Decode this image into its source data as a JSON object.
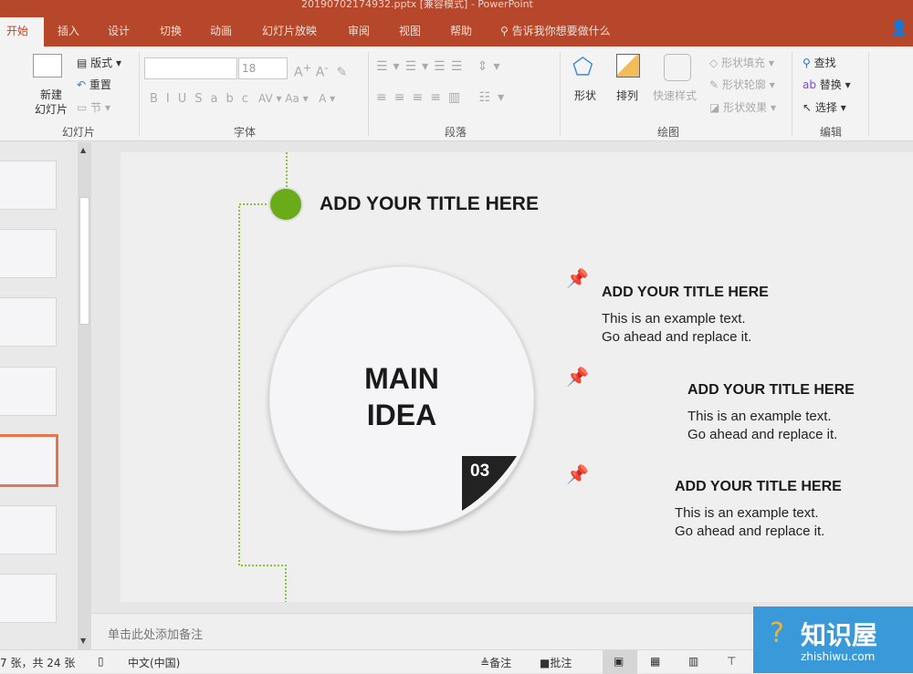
{
  "window": {
    "title": "20190702174932.pptx [兼容模式] - PowerPoint"
  },
  "tabs": [
    "开始",
    "插入",
    "设计",
    "切换",
    "动画",
    "幻灯片放映",
    "审阅",
    "视图",
    "帮助"
  ],
  "tell_me": "告诉我你想要做什么",
  "ribbon": {
    "slides": {
      "label": "幻灯片",
      "new_slide": "新建\n幻灯片",
      "layout": "版式",
      "reset": "重置",
      "section": "节"
    },
    "font": {
      "label": "字体",
      "font_name": "",
      "font_size": "18"
    },
    "paragraph": {
      "label": "段落"
    },
    "drawing": {
      "label": "绘图",
      "shapes": "形状",
      "arrange": "排列",
      "quick_styles": "快速样式",
      "fill": "形状填充",
      "outline": "形状轮廓",
      "effects": "形状效果"
    },
    "editing": {
      "label": "编辑",
      "find": "查找",
      "replace": "替换",
      "select": "选择"
    }
  },
  "slide": {
    "main_title": "ADD YOUR TITLE HERE",
    "center": [
      "MAIN",
      "IDEA"
    ],
    "badge": "03",
    "items": [
      {
        "title": "ADD YOUR TITLE HERE",
        "lines": [
          "This is an example text.",
          "Go ahead and replace it."
        ]
      },
      {
        "title": "ADD YOUR TITLE HERE",
        "lines": [
          "This is an example text.",
          "Go ahead and replace it."
        ]
      },
      {
        "title": "ADD YOUR TITLE HERE",
        "lines": [
          "This is an example text.",
          "Go ahead and replace it."
        ]
      }
    ],
    "accent": "#6aab1a"
  },
  "notes_placeholder": "单击此处添加备注",
  "status": {
    "slide_count": "7 张，共 24 张",
    "language": "中文(中国)",
    "notes": "备注",
    "comments": "批注"
  },
  "watermark": {
    "name": "知识屋",
    "url": "zhishiwu.com"
  },
  "current_slide": 7,
  "colors": {
    "brand": "#b7472a",
    "selection": "#e8734f"
  }
}
